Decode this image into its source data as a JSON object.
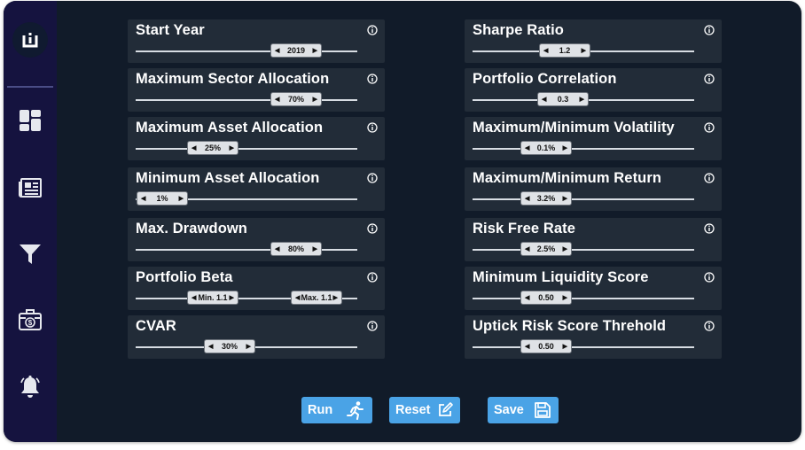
{
  "sidebar": {
    "logo": "ui-logo",
    "items": [
      {
        "name": "dashboard-icon"
      },
      {
        "name": "newspaper-icon"
      },
      {
        "name": "filter-icon"
      },
      {
        "name": "briefcase-dollar-icon"
      },
      {
        "name": "bell-icon"
      }
    ]
  },
  "left_panels": [
    {
      "title": "Start Year",
      "values": [
        "2019"
      ]
    },
    {
      "title": "Maximum Sector Allocation",
      "values": [
        "70%"
      ]
    },
    {
      "title": "Maximum Asset Allocation",
      "values": [
        "25%"
      ]
    },
    {
      "title": "Minimum Asset Allocation",
      "values": [
        "1%"
      ]
    },
    {
      "title": "Max. Drawdown",
      "values": [
        "80%"
      ]
    },
    {
      "title": "Portfolio Beta",
      "values": [
        "Min. 1.1",
        "Max. 1.1"
      ]
    },
    {
      "title": "CVAR",
      "values": [
        "30%"
      ]
    }
  ],
  "right_panels": [
    {
      "title": "Sharpe Ratio",
      "values": [
        "1.2"
      ]
    },
    {
      "title": "Portfolio Correlation",
      "values": [
        "0.3"
      ]
    },
    {
      "title": "Maximum/Minimum Volatility",
      "values": [
        "0.1%"
      ]
    },
    {
      "title": "Maximum/Minimum Return",
      "values": [
        "3.2%"
      ]
    },
    {
      "title": "Risk Free Rate",
      "values": [
        "2.5%"
      ]
    },
    {
      "title": "Minimum Liquidity Score",
      "values": [
        "0.50"
      ]
    },
    {
      "title": "Uptick Risk Score Threhold",
      "values": [
        "0.50"
      ]
    }
  ],
  "buttons": {
    "run": "Run",
    "reset": "Reset",
    "save": "Save"
  },
  "colors": {
    "background": "#111b29",
    "sidebar": "#15133f",
    "panel": "#222c38",
    "accent": "#4aa3e6",
    "text": "#ffffff"
  }
}
